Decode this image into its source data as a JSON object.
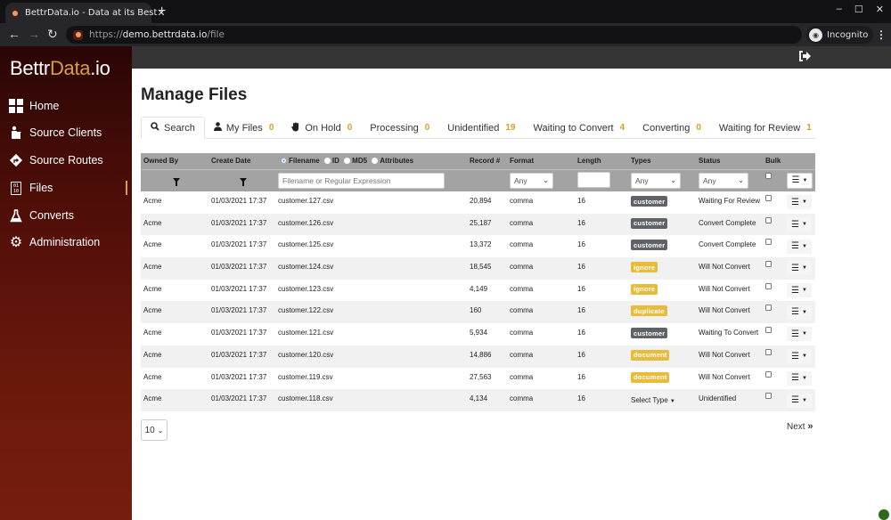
{
  "browser": {
    "tab_title": "BettrData.io - Data at its Best",
    "url_scheme": "https://",
    "url_host": "demo.bettrdata.io",
    "url_path": "/file",
    "profile_label": "Incognito"
  },
  "sidebar": {
    "logo_main": "Bettr",
    "logo_accent": "Data",
    "logo_suffix": ".io",
    "items": [
      {
        "label": "Home",
        "icon": "grid-icon"
      },
      {
        "label": "Source Clients",
        "icon": "person-trash-icon"
      },
      {
        "label": "Source Routes",
        "icon": "route-sign-icon"
      },
      {
        "label": "Files",
        "icon": "binary-file-icon",
        "active": true
      },
      {
        "label": "Converts",
        "icon": "flask-icon"
      },
      {
        "label": "Administration",
        "icon": "gear-icon"
      }
    ],
    "accent_color": "#d4a041"
  },
  "page": {
    "title": "Manage Files"
  },
  "tabs": [
    {
      "label": "Search",
      "icon": "search-icon",
      "count": null,
      "active": true
    },
    {
      "label": "My Files",
      "icon": "user-icon",
      "count": "0"
    },
    {
      "label": "On Hold",
      "icon": "hand-icon",
      "count": "0"
    },
    {
      "label": "Processing",
      "count": "0"
    },
    {
      "label": "Unidentified",
      "count": "19"
    },
    {
      "label": "Waiting to Convert",
      "count": "4"
    },
    {
      "label": "Converting",
      "count": "0"
    },
    {
      "label": "Waiting for Review",
      "count": "1"
    }
  ],
  "table": {
    "headers": {
      "owned_by": "Owned By",
      "create_date": "Create Date",
      "search_modes": [
        "Filename",
        "ID",
        "MD5",
        "Attributes"
      ],
      "search_mode_selected": "Filename",
      "record": "Record #",
      "format": "Format",
      "length": "Length",
      "types": "Types",
      "status": "Status",
      "bulk": "Bulk"
    },
    "filters": {
      "filename_placeholder": "Filename or Regular Expression",
      "format_value": "Any",
      "length_value": "",
      "types_value": "Any",
      "status_value": "Any"
    },
    "rows": [
      {
        "owner": "Acme",
        "date": "01/03/2021 17:37",
        "filename": "customer.127.csv",
        "records": "20,894",
        "format": "comma",
        "length": "16",
        "type": "customer",
        "type_style": "dark",
        "status": "Waiting For Review"
      },
      {
        "owner": "Acme",
        "date": "01/03/2021 17:37",
        "filename": "customer.126.csv",
        "records": "25,187",
        "format": "comma",
        "length": "16",
        "type": "customer",
        "type_style": "dark",
        "status": "Convert Complete"
      },
      {
        "owner": "Acme",
        "date": "01/03/2021 17:37",
        "filename": "customer.125.csv",
        "records": "13,372",
        "format": "comma",
        "length": "16",
        "type": "customer",
        "type_style": "dark",
        "status": "Convert Complete"
      },
      {
        "owner": "Acme",
        "date": "01/03/2021 17:37",
        "filename": "customer.124.csv",
        "records": "18,545",
        "format": "comma",
        "length": "16",
        "type": "ignore",
        "type_style": "warn",
        "status": "Will Not Convert"
      },
      {
        "owner": "Acme",
        "date": "01/03/2021 17:37",
        "filename": "customer.123.csv",
        "records": "4,149",
        "format": "comma",
        "length": "16",
        "type": "ignore",
        "type_style": "warn",
        "status": "Will Not Convert"
      },
      {
        "owner": "Acme",
        "date": "01/03/2021 17:37",
        "filename": "customer.122.csv",
        "records": "160",
        "format": "comma",
        "length": "16",
        "type": "duplicate",
        "type_style": "warn",
        "status": "Will Not Convert"
      },
      {
        "owner": "Acme",
        "date": "01/03/2021 17:37",
        "filename": "customer.121.csv",
        "records": "5,934",
        "format": "comma",
        "length": "16",
        "type": "customer",
        "type_style": "dark",
        "status": "Waiting To Convert"
      },
      {
        "owner": "Acme",
        "date": "01/03/2021 17:37",
        "filename": "customer.120.csv",
        "records": "14,886",
        "format": "comma",
        "length": "16",
        "type": "document",
        "type_style": "warn",
        "status": "Will Not Convert"
      },
      {
        "owner": "Acme",
        "date": "01/03/2021 17:37",
        "filename": "customer.119.csv",
        "records": "27,563",
        "format": "comma",
        "length": "16",
        "type": "document",
        "type_style": "warn",
        "status": "Will Not Convert"
      },
      {
        "owner": "Acme",
        "date": "01/03/2021 17:37",
        "filename": "customer.118.csv",
        "records": "4,134",
        "format": "comma",
        "length": "16",
        "type": null,
        "type_select_label": "Select Type",
        "status": "Unidentified"
      }
    ]
  },
  "pagination": {
    "page_size": "10",
    "next_label": "Next"
  }
}
